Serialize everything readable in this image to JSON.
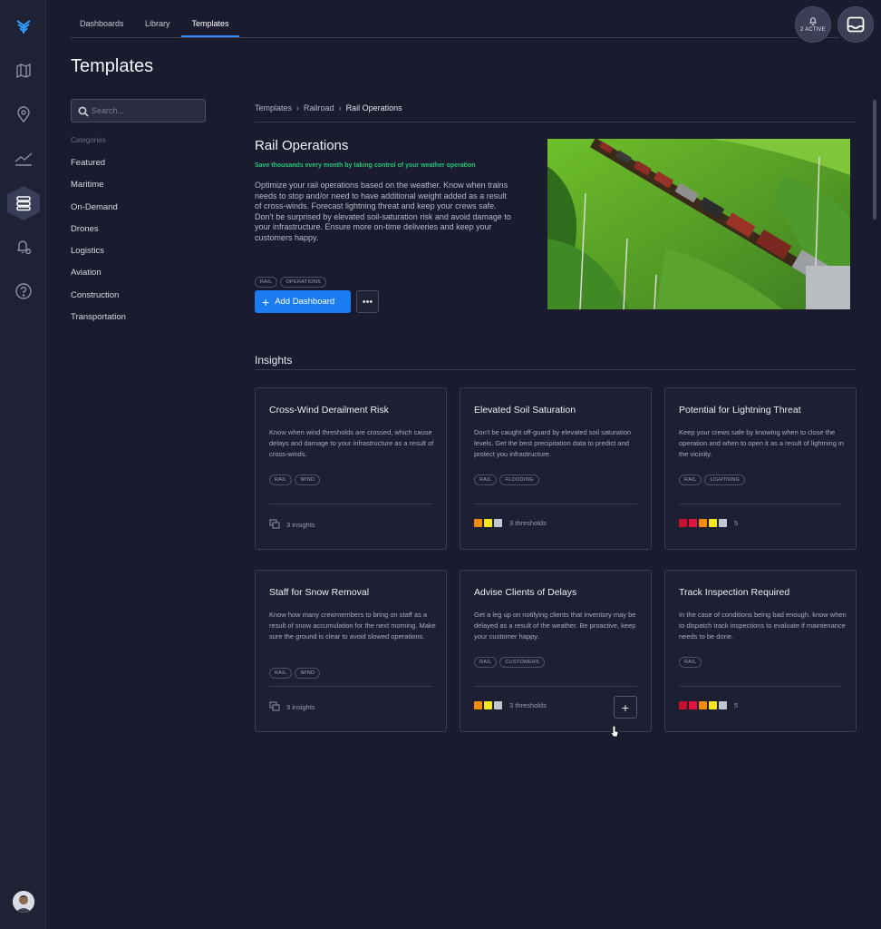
{
  "colors": {
    "accent": "#1b7cf2",
    "tagline": "#27c27a",
    "background": "#1a1b2e"
  },
  "sidebar_icons": [
    "logo-icon",
    "map-icon",
    "location-pin-icon",
    "trend-chart-icon",
    "templates-icon",
    "alert-bell-icon",
    "help-icon"
  ],
  "nav": {
    "tabs": [
      "Dashboards",
      "Library",
      "Templates"
    ],
    "active_tab": "Templates"
  },
  "header": {
    "active_count_label": "2 ACTIVE"
  },
  "page": {
    "title": "Templates"
  },
  "search": {
    "placeholder": "Search..."
  },
  "categories": {
    "title": "Categories",
    "items": [
      "Featured",
      "Maritime",
      "On-Demand",
      "Drones",
      "Logistics",
      "Aviation",
      "Construction",
      "Transportation"
    ]
  },
  "breadcrumb": [
    "Templates",
    "Railroad",
    "Rail Operations"
  ],
  "template": {
    "title": "Rail Operations",
    "tagline": "Save thousands every month by taking control of your weather operation",
    "description": "Optimize your rail operations based on the weather. Know when trains needs to stop and/or need to have additional weight added as a result of cross-winds. Forecast lightning threat and keep your crews safe. Don't be surprised by elevated soil-saturation risk and avoid damage to your infrastructure. Ensure more on-time deliveries and keep your customers happy.",
    "tags": [
      "RAIL",
      "OPERATIONS"
    ],
    "add_label": "Add Dashboard",
    "more_label": "•••"
  },
  "insights": {
    "title": "Insights",
    "cards": [
      {
        "title": "Cross-Wind Derailment Risk",
        "desc": "Know when wind thresholds are crossed, which cause delays and damage to your infrastructure as a result of cross-winds.",
        "tags": [
          "RAIL",
          "WIND"
        ],
        "footer_kind": "insights",
        "footer": "3 insights",
        "swatches": []
      },
      {
        "title": "Elevated Soil Saturation",
        "desc": "Don't be caught off-guard by elevated soil saturation levels. Get the best precipitation data to predict and protect you infrastructure.",
        "tags": [
          "RAIL",
          "FLOODING"
        ],
        "footer_kind": "thresholds",
        "footer": "3 thresholds",
        "swatches": [
          "#f28c00",
          "#f5e61e",
          "#c3c5d0"
        ]
      },
      {
        "title": "Potential for Lightning Threat",
        "desc": "Keep your crews safe by knowing when to close the operation and when to open it as a result of lightning in the vicinity.",
        "tags": [
          "RAIL",
          "LIGHTNING"
        ],
        "footer_kind": "thresholds",
        "footer": "5",
        "swatches": [
          "#c8102e",
          "#e0143c",
          "#f28c00",
          "#f5e61e",
          "#c3c5d0"
        ]
      },
      {
        "title": "Staff for Snow Removal",
        "desc": "Know how many crewmembers to bring on staff as a result of snow accumulation for the next morning. Make sure the ground is clear to avoid slowed operations.",
        "tags": [
          "RAIL",
          "WIND"
        ],
        "footer_kind": "insights",
        "footer": "3 insights",
        "swatches": []
      },
      {
        "title": "Advise Clients of Delays",
        "desc": "Get a leg up on notifying clients that inventory may be delayed as a result of the weather. Be proactive, keep your customer happy.",
        "tags": [
          "RAIL",
          "CUSTOMERS"
        ],
        "footer_kind": "thresholds",
        "footer": "3 thresholds",
        "swatches": [
          "#f28c00",
          "#f5e61e",
          "#c3c5d0"
        ],
        "show_add": true
      },
      {
        "title": "Track Inspection Required",
        "desc": "In the case of conditions being bad enough, know when to dispatch track inspections to evaluate if maintenance needs to be done.",
        "tags": [
          "RAIL"
        ],
        "footer_kind": "thresholds",
        "footer": "5",
        "swatches": [
          "#c8102e",
          "#e0143c",
          "#f28c00",
          "#f5e61e",
          "#c3c5d0"
        ]
      }
    ]
  }
}
